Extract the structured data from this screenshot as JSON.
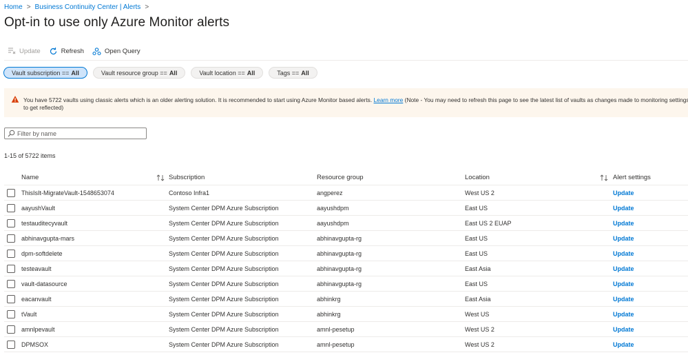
{
  "breadcrumb": {
    "items": [
      "Home",
      "Business Continuity Center | Alerts"
    ]
  },
  "page": {
    "title": "Opt-in to use only Azure Monitor alerts",
    "more": "···"
  },
  "toolbar": {
    "update_label": "Update",
    "refresh_label": "Refresh",
    "open_query_label": "Open Query"
  },
  "filters": [
    {
      "label": "Vault subscription ==",
      "value": "All"
    },
    {
      "label": "Vault resource group ==",
      "value": "All"
    },
    {
      "label": "Vault location ==",
      "value": "All"
    },
    {
      "label": "Tags ==",
      "value": "All"
    }
  ],
  "banner": {
    "text_before": "You have 5722 vaults using classic alerts which is an older alerting solution. It is recommended to start using Azure Monitor based alerts. ",
    "link": "Learn more",
    "text_after": " (Note - You may need to refresh this page to see the latest list of vaults as changes made to monitoring settings ca",
    "line2": "to get reflected)"
  },
  "search": {
    "placeholder": "Filter by name"
  },
  "count_text": "1-15 of 5722 items",
  "table": {
    "headers": {
      "name": "Name",
      "subscription": "Subscription",
      "resource_group": "Resource group",
      "location": "Location",
      "alert_settings": "Alert settings"
    },
    "rows": [
      {
        "name": "ThisIsIt-MigrateVault-1548653074",
        "subscription": "Contoso Infra1",
        "rg": "angperez",
        "location": "West US 2",
        "action": "Update"
      },
      {
        "name": "aayushVault",
        "subscription": "System Center DPM Azure Subscription",
        "rg": "aayushdpm",
        "location": "East US",
        "action": "Update"
      },
      {
        "name": "testauditecyvault",
        "subscription": "System Center DPM Azure Subscription",
        "rg": "aayushdpm",
        "location": "East US 2 EUAP",
        "action": "Update"
      },
      {
        "name": "abhinavgupta-mars",
        "subscription": "System Center DPM Azure Subscription",
        "rg": "abhinavgupta-rg",
        "location": "East US",
        "action": "Update"
      },
      {
        "name": "dpm-softdelete",
        "subscription": "System Center DPM Azure Subscription",
        "rg": "abhinavgupta-rg",
        "location": "East US",
        "action": "Update"
      },
      {
        "name": "testeavault",
        "subscription": "System Center DPM Azure Subscription",
        "rg": "abhinavgupta-rg",
        "location": "East Asia",
        "action": "Update"
      },
      {
        "name": "vault-datasource",
        "subscription": "System Center DPM Azure Subscription",
        "rg": "abhinavgupta-rg",
        "location": "East US",
        "action": "Update"
      },
      {
        "name": "eacanvault",
        "subscription": "System Center DPM Azure Subscription",
        "rg": "abhinkrg",
        "location": "East Asia",
        "action": "Update"
      },
      {
        "name": "tVault",
        "subscription": "System Center DPM Azure Subscription",
        "rg": "abhinkrg",
        "location": "West US",
        "action": "Update"
      },
      {
        "name": "amnlpevault",
        "subscription": "System Center DPM Azure Subscription",
        "rg": "amnl-pesetup",
        "location": "West US 2",
        "action": "Update"
      },
      {
        "name": "DPMSOX",
        "subscription": "System Center DPM Azure Subscription",
        "rg": "amnl-pesetup",
        "location": "West US 2",
        "action": "Update"
      }
    ]
  },
  "colors": {
    "accent": "#0078d4",
    "warning_bg": "#fdf6ed",
    "warning_icon": "#d83b01"
  }
}
